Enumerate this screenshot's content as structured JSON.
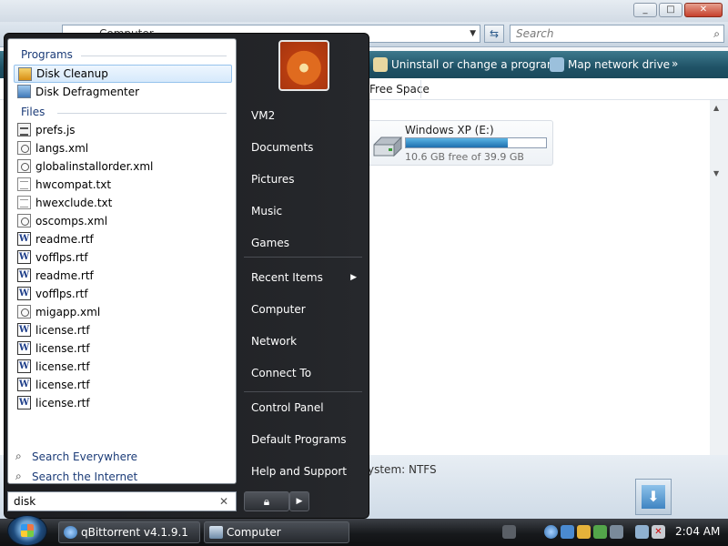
{
  "explorer": {
    "address": "Computer",
    "search_placeholder": "Search",
    "commands": [
      "Uninstall or change a program",
      "Map network drive",
      "»"
    ],
    "header_column": "Free Space",
    "drive": {
      "name": "Windows XP (E:)",
      "free_text": "10.6 GB free of 39.9 GB",
      "used_fraction": 0.73
    },
    "details_filesystem": "ystem: NTFS",
    "window_buttons": [
      "_",
      "□",
      "✕"
    ]
  },
  "start_menu": {
    "programs_label": "Programs",
    "programs": [
      {
        "label": "Disk Cleanup",
        "icon": "disk-cleanup-icon",
        "selected": true
      },
      {
        "label": "Disk Defragmenter",
        "icon": "defrag-icon",
        "selected": false
      }
    ],
    "files_label": "Files",
    "files": [
      {
        "label": "prefs.js",
        "icon": "js"
      },
      {
        "label": "langs.xml",
        "icon": "xml"
      },
      {
        "label": "globalinstallorder.xml",
        "icon": "xml"
      },
      {
        "label": "hwcompat.txt",
        "icon": "txt"
      },
      {
        "label": "hwexclude.txt",
        "icon": "txt"
      },
      {
        "label": "oscomps.xml",
        "icon": "xml"
      },
      {
        "label": "readme.rtf",
        "icon": "rtf"
      },
      {
        "label": "vofflps.rtf",
        "icon": "rtf"
      },
      {
        "label": "readme.rtf",
        "icon": "rtf"
      },
      {
        "label": "vofflps.rtf",
        "icon": "rtf"
      },
      {
        "label": "migapp.xml",
        "icon": "xml"
      },
      {
        "label": "license.rtf",
        "icon": "rtf"
      },
      {
        "label": "license.rtf",
        "icon": "rtf"
      },
      {
        "label": "license.rtf",
        "icon": "rtf"
      },
      {
        "label": "license.rtf",
        "icon": "rtf"
      },
      {
        "label": "license.rtf",
        "icon": "rtf"
      }
    ],
    "search_everywhere": "Search Everywhere",
    "search_internet": "Search the Internet",
    "search_value": "disk",
    "right_items": [
      {
        "label": "VM2"
      },
      {
        "label": "Documents"
      },
      {
        "label": "Pictures"
      },
      {
        "label": "Music"
      },
      {
        "label": "Games"
      },
      {
        "label": "Recent Items",
        "submenu": true
      },
      {
        "label": "Computer"
      },
      {
        "label": "Network"
      },
      {
        "label": "Connect To"
      },
      {
        "label": "Control Panel"
      },
      {
        "label": "Default Programs"
      },
      {
        "label": "Help and Support"
      }
    ]
  },
  "taskbar": {
    "buttons": [
      "qBittorrent v4.1.9.1",
      "Computer"
    ],
    "clock": "2:04 AM"
  }
}
